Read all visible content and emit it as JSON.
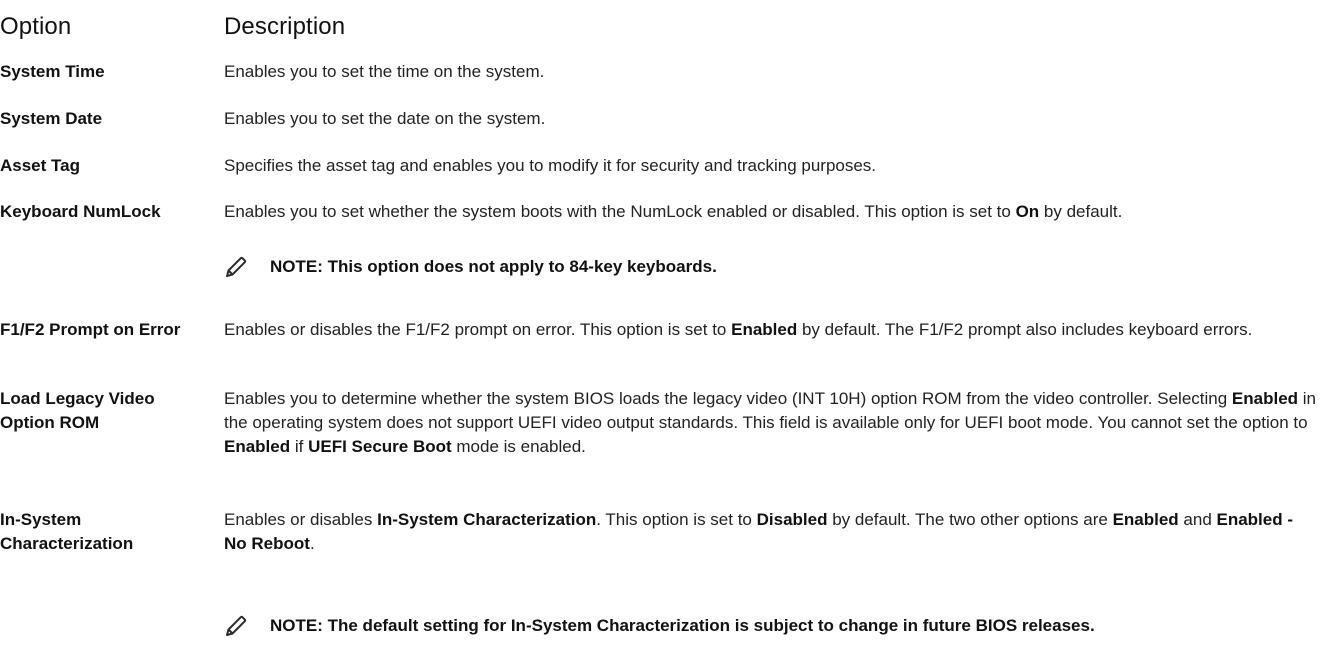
{
  "header": {
    "option": "Option",
    "description": "Description"
  },
  "rows": [
    {
      "name": "System Time",
      "desc": "Enables you to set the time on the system."
    },
    {
      "name": "System Date",
      "desc": "Enables you to set the date on the system."
    },
    {
      "name": "Asset Tag",
      "desc": "Specifies the asset tag and enables you to modify it for security and tracking purposes."
    },
    {
      "name": "Keyboard NumLock",
      "desc": [
        {
          "t": "Enables you to set whether the system boots with the NumLock enabled or disabled. This option is set to "
        },
        {
          "t": "On",
          "b": true
        },
        {
          "t": " by default."
        }
      ],
      "note": "NOTE: This option does not apply to 84-key keyboards."
    },
    {
      "name": "F1/F2 Prompt on Error",
      "desc": [
        {
          "t": "Enables or disables the F1/F2 prompt on error. This option is set to "
        },
        {
          "t": "Enabled",
          "b": true
        },
        {
          "t": " by default. The F1/F2 prompt also includes keyboard errors."
        }
      ]
    },
    {
      "name": "Load Legacy Video Option ROM",
      "desc": [
        {
          "t": "Enables you to determine whether the system BIOS loads the legacy video (INT 10H) option ROM from the video controller. Selecting "
        },
        {
          "t": "Enabled",
          "b": true
        },
        {
          "t": " in the operating system does not support UEFI video output standards. This field is available only for UEFI boot mode. You cannot set the option to "
        },
        {
          "t": "Enabled",
          "b": true
        },
        {
          "t": " if "
        },
        {
          "t": "UEFI Secure Boot",
          "b": true
        },
        {
          "t": " mode is enabled."
        }
      ]
    },
    {
      "name": "In-System Characterization",
      "desc": [
        {
          "t": "Enables or disables "
        },
        {
          "t": "In-System Characterization",
          "b": true
        },
        {
          "t": ". This option is set to "
        },
        {
          "t": "Disabled",
          "b": true
        },
        {
          "t": " by default. The two other options are "
        },
        {
          "t": "Enabled",
          "b": true
        },
        {
          "t": " and "
        },
        {
          "t": "Enabled - No Reboot",
          "b": true
        },
        {
          "t": "."
        }
      ],
      "note": "NOTE: The default setting for In-System Characterization is subject to change in future BIOS releases."
    }
  ],
  "colors": {
    "text": "#1a1a1a",
    "icon": "#2b2b2b"
  },
  "icons": {
    "note": "pencil-icon"
  }
}
